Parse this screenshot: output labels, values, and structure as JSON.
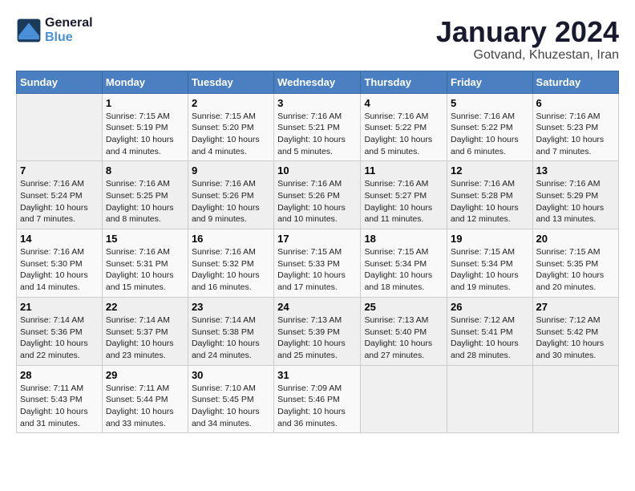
{
  "logo": {
    "text_general": "General",
    "text_blue": "Blue"
  },
  "header": {
    "month_year": "January 2024",
    "location": "Gotvand, Khuzestan, Iran"
  },
  "weekdays": [
    "Sunday",
    "Monday",
    "Tuesday",
    "Wednesday",
    "Thursday",
    "Friday",
    "Saturday"
  ],
  "weeks": [
    [
      {
        "day": "",
        "sunrise": "",
        "sunset": "",
        "daylight": ""
      },
      {
        "day": "1",
        "sunrise": "Sunrise: 7:15 AM",
        "sunset": "Sunset: 5:19 PM",
        "daylight": "Daylight: 10 hours and 4 minutes."
      },
      {
        "day": "2",
        "sunrise": "Sunrise: 7:15 AM",
        "sunset": "Sunset: 5:20 PM",
        "daylight": "Daylight: 10 hours and 4 minutes."
      },
      {
        "day": "3",
        "sunrise": "Sunrise: 7:16 AM",
        "sunset": "Sunset: 5:21 PM",
        "daylight": "Daylight: 10 hours and 5 minutes."
      },
      {
        "day": "4",
        "sunrise": "Sunrise: 7:16 AM",
        "sunset": "Sunset: 5:22 PM",
        "daylight": "Daylight: 10 hours and 5 minutes."
      },
      {
        "day": "5",
        "sunrise": "Sunrise: 7:16 AM",
        "sunset": "Sunset: 5:22 PM",
        "daylight": "Daylight: 10 hours and 6 minutes."
      },
      {
        "day": "6",
        "sunrise": "Sunrise: 7:16 AM",
        "sunset": "Sunset: 5:23 PM",
        "daylight": "Daylight: 10 hours and 7 minutes."
      }
    ],
    [
      {
        "day": "7",
        "sunrise": "Sunrise: 7:16 AM",
        "sunset": "Sunset: 5:24 PM",
        "daylight": "Daylight: 10 hours and 7 minutes."
      },
      {
        "day": "8",
        "sunrise": "Sunrise: 7:16 AM",
        "sunset": "Sunset: 5:25 PM",
        "daylight": "Daylight: 10 hours and 8 minutes."
      },
      {
        "day": "9",
        "sunrise": "Sunrise: 7:16 AM",
        "sunset": "Sunset: 5:26 PM",
        "daylight": "Daylight: 10 hours and 9 minutes."
      },
      {
        "day": "10",
        "sunrise": "Sunrise: 7:16 AM",
        "sunset": "Sunset: 5:26 PM",
        "daylight": "Daylight: 10 hours and 10 minutes."
      },
      {
        "day": "11",
        "sunrise": "Sunrise: 7:16 AM",
        "sunset": "Sunset: 5:27 PM",
        "daylight": "Daylight: 10 hours and 11 minutes."
      },
      {
        "day": "12",
        "sunrise": "Sunrise: 7:16 AM",
        "sunset": "Sunset: 5:28 PM",
        "daylight": "Daylight: 10 hours and 12 minutes."
      },
      {
        "day": "13",
        "sunrise": "Sunrise: 7:16 AM",
        "sunset": "Sunset: 5:29 PM",
        "daylight": "Daylight: 10 hours and 13 minutes."
      }
    ],
    [
      {
        "day": "14",
        "sunrise": "Sunrise: 7:16 AM",
        "sunset": "Sunset: 5:30 PM",
        "daylight": "Daylight: 10 hours and 14 minutes."
      },
      {
        "day": "15",
        "sunrise": "Sunrise: 7:16 AM",
        "sunset": "Sunset: 5:31 PM",
        "daylight": "Daylight: 10 hours and 15 minutes."
      },
      {
        "day": "16",
        "sunrise": "Sunrise: 7:16 AM",
        "sunset": "Sunset: 5:32 PM",
        "daylight": "Daylight: 10 hours and 16 minutes."
      },
      {
        "day": "17",
        "sunrise": "Sunrise: 7:15 AM",
        "sunset": "Sunset: 5:33 PM",
        "daylight": "Daylight: 10 hours and 17 minutes."
      },
      {
        "day": "18",
        "sunrise": "Sunrise: 7:15 AM",
        "sunset": "Sunset: 5:34 PM",
        "daylight": "Daylight: 10 hours and 18 minutes."
      },
      {
        "day": "19",
        "sunrise": "Sunrise: 7:15 AM",
        "sunset": "Sunset: 5:34 PM",
        "daylight": "Daylight: 10 hours and 19 minutes."
      },
      {
        "day": "20",
        "sunrise": "Sunrise: 7:15 AM",
        "sunset": "Sunset: 5:35 PM",
        "daylight": "Daylight: 10 hours and 20 minutes."
      }
    ],
    [
      {
        "day": "21",
        "sunrise": "Sunrise: 7:14 AM",
        "sunset": "Sunset: 5:36 PM",
        "daylight": "Daylight: 10 hours and 22 minutes."
      },
      {
        "day": "22",
        "sunrise": "Sunrise: 7:14 AM",
        "sunset": "Sunset: 5:37 PM",
        "daylight": "Daylight: 10 hours and 23 minutes."
      },
      {
        "day": "23",
        "sunrise": "Sunrise: 7:14 AM",
        "sunset": "Sunset: 5:38 PM",
        "daylight": "Daylight: 10 hours and 24 minutes."
      },
      {
        "day": "24",
        "sunrise": "Sunrise: 7:13 AM",
        "sunset": "Sunset: 5:39 PM",
        "daylight": "Daylight: 10 hours and 25 minutes."
      },
      {
        "day": "25",
        "sunrise": "Sunrise: 7:13 AM",
        "sunset": "Sunset: 5:40 PM",
        "daylight": "Daylight: 10 hours and 27 minutes."
      },
      {
        "day": "26",
        "sunrise": "Sunrise: 7:12 AM",
        "sunset": "Sunset: 5:41 PM",
        "daylight": "Daylight: 10 hours and 28 minutes."
      },
      {
        "day": "27",
        "sunrise": "Sunrise: 7:12 AM",
        "sunset": "Sunset: 5:42 PM",
        "daylight": "Daylight: 10 hours and 30 minutes."
      }
    ],
    [
      {
        "day": "28",
        "sunrise": "Sunrise: 7:11 AM",
        "sunset": "Sunset: 5:43 PM",
        "daylight": "Daylight: 10 hours and 31 minutes."
      },
      {
        "day": "29",
        "sunrise": "Sunrise: 7:11 AM",
        "sunset": "Sunset: 5:44 PM",
        "daylight": "Daylight: 10 hours and 33 minutes."
      },
      {
        "day": "30",
        "sunrise": "Sunrise: 7:10 AM",
        "sunset": "Sunset: 5:45 PM",
        "daylight": "Daylight: 10 hours and 34 minutes."
      },
      {
        "day": "31",
        "sunrise": "Sunrise: 7:09 AM",
        "sunset": "Sunset: 5:46 PM",
        "daylight": "Daylight: 10 hours and 36 minutes."
      },
      {
        "day": "",
        "sunrise": "",
        "sunset": "",
        "daylight": ""
      },
      {
        "day": "",
        "sunrise": "",
        "sunset": "",
        "daylight": ""
      },
      {
        "day": "",
        "sunrise": "",
        "sunset": "",
        "daylight": ""
      }
    ]
  ]
}
